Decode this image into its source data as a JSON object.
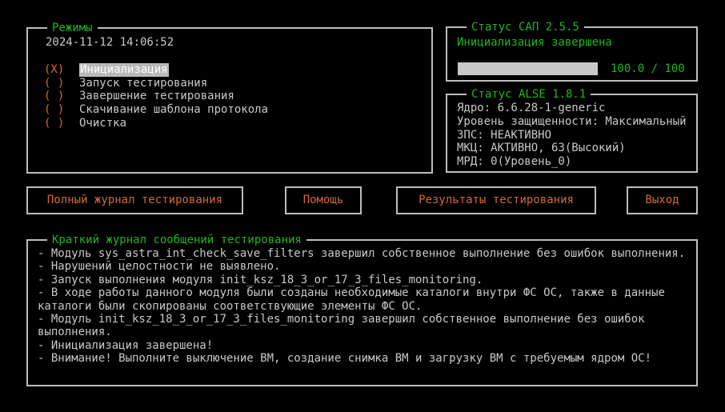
{
  "modes": {
    "title": "Режимы",
    "datetime": "2024-11-12 14:06:52",
    "items": [
      {
        "radio": "(X)",
        "label": "Инициализация",
        "selected": true
      },
      {
        "radio": "( )",
        "label": "Запуск тестирования",
        "selected": false
      },
      {
        "radio": "( )",
        "label": "Завершение тестирования",
        "selected": false
      },
      {
        "radio": "( )",
        "label": "Скачивание шаблона протокола",
        "selected": false
      },
      {
        "radio": "( )",
        "label": "Очистка",
        "selected": false
      }
    ]
  },
  "sap_status": {
    "title": "Статус САП 2.5.5",
    "state": "Инициализация завершена",
    "progress_text": "100.0 / 100",
    "progress_fraction": 1.0
  },
  "alse_status": {
    "title": "Статус ALSE 1.8.1",
    "lines": [
      "Ядро: 6.6.28-1-generic",
      "Уровень защищенности: Максимальный",
      "ЗПС: НЕАКТИВНО",
      "МКЦ: АКТИВНО, 63(Высокий)",
      "МРД: 0(Уровень_0)"
    ]
  },
  "buttons": {
    "full_log": "Полный журнал тестирования",
    "help": "Помощь",
    "results": "Результаты тестирования",
    "exit": "Выход"
  },
  "log": {
    "title": "Краткий журнал сообщений тестирования",
    "entries": [
      "- Модуль sys_astra_int_check_save_filters завершил собственное выполнение без ошибок выполнения.",
      "- Нарушений целостности не выявлено.",
      "- Запуск выполнения модуля init_ksz_18_3_or_17_3_files_monitoring.",
      "- В ходе работы данного модуля были созданы необходимые каталоги внутри ФС ОС, также в данные каталоги были скопированы соответствующие элементы ФС ОС.",
      "- Модуль init_ksz_18_3_or_17_3_files_monitoring завершил собственное выполнение без ошибок выполнения.",
      "- Инициализация завершена!",
      "- Внимание! Выполните выключение ВМ, создание снимка ВМ и загрузку ВМ с требуемым ядром ОС!"
    ]
  },
  "colors": {
    "green": "#22b51f",
    "orange": "#d26a38",
    "border": "#bdbdbd",
    "text": "#c8c8c8",
    "background": "#000000"
  }
}
